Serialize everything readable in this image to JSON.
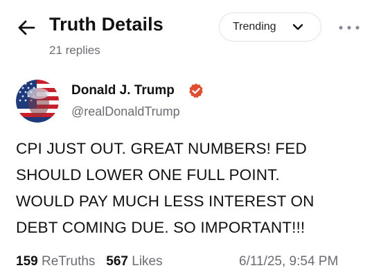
{
  "header": {
    "title": "Truth Details",
    "reply_count": "21 replies",
    "sort": {
      "selected": "Trending"
    },
    "icons": {
      "back": "arrow-left-icon",
      "sort": "chevron-down-icon",
      "more": "more-horizontal-icon"
    }
  },
  "post": {
    "author": {
      "name": "Donald J. Trump",
      "handle": "@realDonaldTrump",
      "verified": true,
      "verified_color": "#e04e32"
    },
    "body_lines": [
      "CPI JUST OUT. GREAT NUMBERS! FED",
      "SHOULD LOWER ONE FULL POINT.",
      "WOULD PAY MUCH LESS INTEREST ON",
      "DEBT COMING DUE. SO IMPORTANT!!!"
    ],
    "stats": {
      "retruths_count": "159",
      "retruths_label": "ReTruths",
      "likes_count": "567",
      "likes_label": "Likes"
    },
    "timestamp": "6/11/25, 9:54 PM"
  }
}
